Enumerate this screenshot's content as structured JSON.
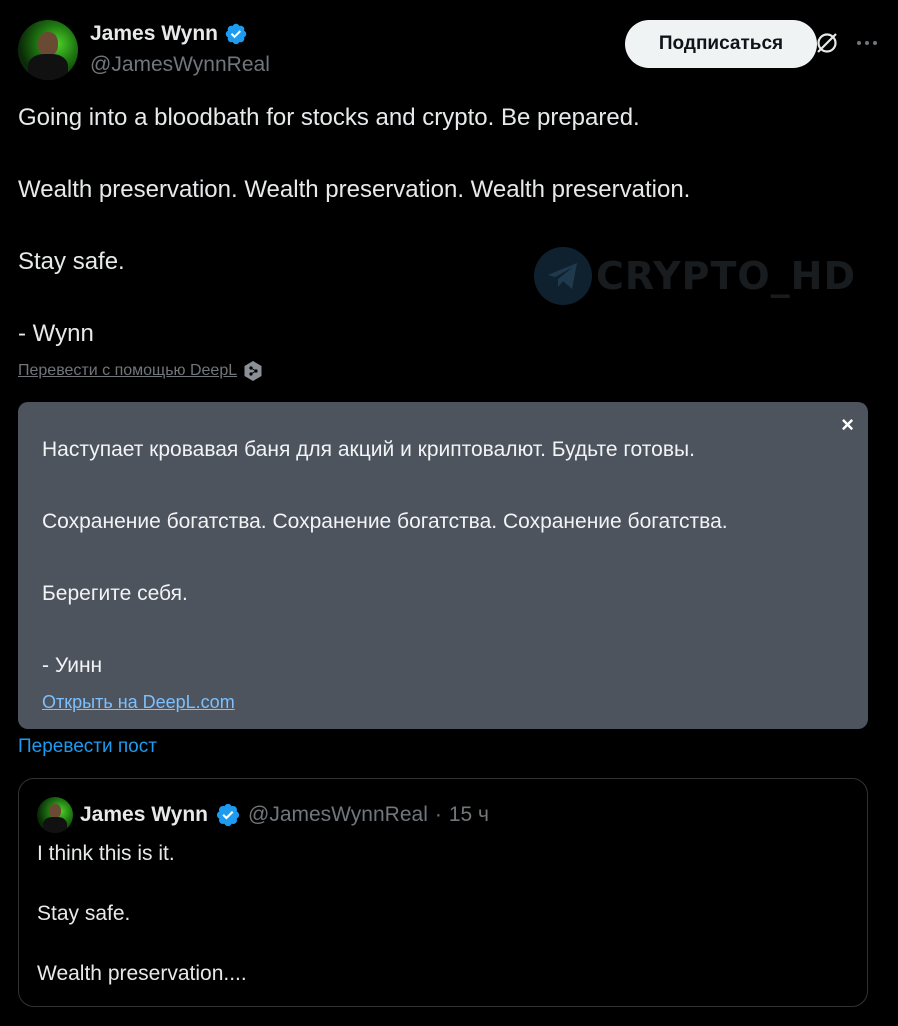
{
  "author": {
    "display_name": "James Wynn",
    "handle": "@JamesWynnReal",
    "follow_label": "Подписаться"
  },
  "tweet": {
    "lines": [
      "Going into a bloodbath for stocks and crypto. Be prepared.",
      "Wealth preservation. Wealth preservation. Wealth preservation.",
      "Stay safe.",
      "- Wynn"
    ]
  },
  "watermark": {
    "text": "CRYPTO_HD"
  },
  "translation": {
    "link_label": "Перевести с помощью DeepL",
    "close_label": "×",
    "lines": [
      "Наступает кровавая баня для акций и криптовалют. Будьте готовы.",
      "Сохранение богатства. Сохранение богатства. Сохранение богатства.",
      "Берегите себя.",
      "- Уинн"
    ],
    "open_label": "Открыть на DeepL.com",
    "translate_post_label": "Перевести пост"
  },
  "quote": {
    "display_name": "James Wynn",
    "handle": "@JamesWynnReal",
    "separator": "·",
    "time": "15 ч",
    "lines": [
      "I think this is it.",
      "Stay safe.",
      "Wealth preservation...."
    ]
  },
  "colors": {
    "background": "#000000",
    "accent": "#1d9bf0",
    "verified": "#1d9bf0",
    "translation_bg": "#4d545e"
  },
  "icons": [
    "verified-badge-icon",
    "grok-icon",
    "more-icon",
    "deepl-logo-icon",
    "close-icon",
    "telegram-icon"
  ]
}
